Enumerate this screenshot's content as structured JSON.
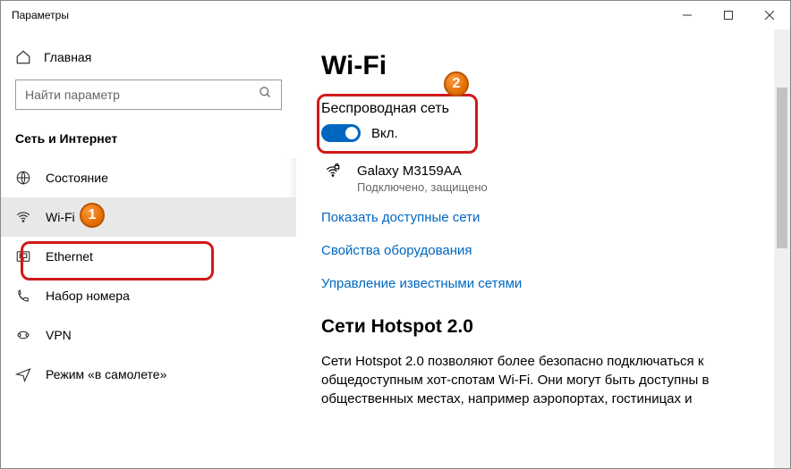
{
  "window": {
    "title": "Параметры"
  },
  "sidebar": {
    "home": "Главная",
    "search_placeholder": "Найти параметр",
    "section": "Сеть и Интернет",
    "items": [
      {
        "label": "Состояние"
      },
      {
        "label": "Wi-Fi"
      },
      {
        "label": "Ethernet"
      },
      {
        "label": "Набор номера"
      },
      {
        "label": "VPN"
      },
      {
        "label": "Режим «в самолете»"
      }
    ]
  },
  "content": {
    "title": "Wi-Fi",
    "wireless_heading": "Беспроводная сеть",
    "toggle_state": "Вкл.",
    "network": {
      "name": "Galaxy M3159AA",
      "status": "Подключено, защищено"
    },
    "links": {
      "show": "Показать доступные сети",
      "hw": "Свойства оборудования",
      "known": "Управление известными сетями"
    },
    "hotspot": {
      "heading": "Сети Hotspot 2.0",
      "text": "Сети Hotspot 2.0 позволяют более безопасно подключаться к общедоступным хот-спотам Wi-Fi. Они могут быть доступны в общественных местах, например аэропортах, гостиницах и"
    }
  },
  "callouts": {
    "b1": "1",
    "b2": "2"
  }
}
